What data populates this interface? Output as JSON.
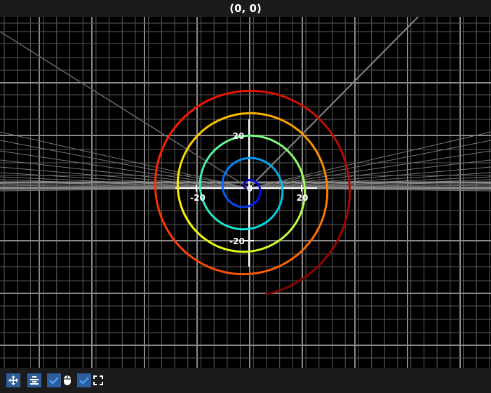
{
  "title": "(0, 0)",
  "toolbar": {
    "buttons": [
      {
        "icon": "move-arrows-icon",
        "label": ""
      },
      {
        "icon": "align-center-icon",
        "label": ""
      },
      {
        "icon": "checkbox-checked-icon",
        "checked": true
      },
      {
        "icon": "mouse-icon"
      },
      {
        "icon": "checkbox-checked-icon",
        "checked": true
      },
      {
        "icon": "fullscreen-icon"
      }
    ],
    "accent": "#2d5d9a"
  },
  "chart_data": {
    "type": "line",
    "projection": "3d-perspective",
    "grid": true,
    "background": "#000000",
    "x_ticks": [
      "-20",
      "20"
    ],
    "y_ticks": [
      "20",
      "-20"
    ],
    "z_tick": "0",
    "series": [
      {
        "kind": "spiral",
        "radius_growth_per_turn": 8.5,
        "turns": 4.8,
        "end_radius": 41,
        "colormap": [
          "#00007f",
          "#0000ff",
          "#0080ff",
          "#00e5e5",
          "#7fff7f",
          "#ffff00",
          "#ff8000",
          "#ff1a00",
          "#800000"
        ]
      }
    ]
  }
}
